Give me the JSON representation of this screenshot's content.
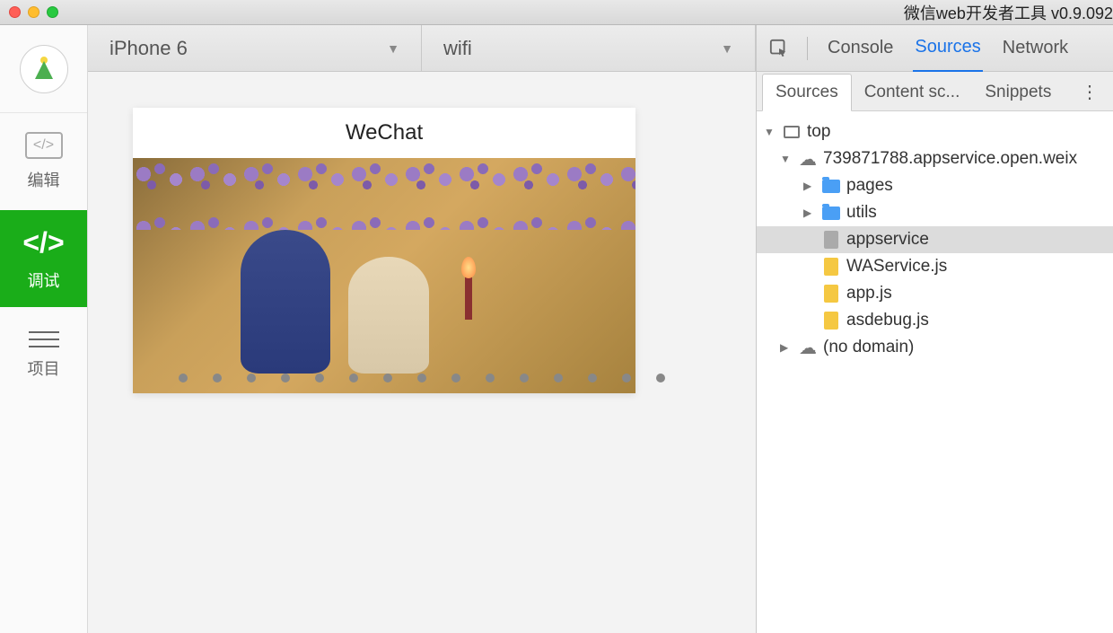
{
  "window": {
    "title": "微信web开发者工具 v0.9.092"
  },
  "sidebar": {
    "edit_label": "编辑",
    "debug_label": "调试",
    "project_label": "项目"
  },
  "toolbar": {
    "device": "iPhone 6",
    "network": "wifi"
  },
  "preview": {
    "header": "WeChat"
  },
  "devtools": {
    "tabs": {
      "console": "Console",
      "sources": "Sources",
      "network": "Network"
    },
    "subtabs": {
      "sources": "Sources",
      "content_scripts": "Content sc...",
      "snippets": "Snippets"
    },
    "tree": {
      "top": "top",
      "domain": "739871788.appservice.open.weix",
      "pages": "pages",
      "utils": "utils",
      "appservice": "appservice",
      "waservice": "WAService.js",
      "appjs": "app.js",
      "asdebug": "asdebug.js",
      "nodomain": "(no domain)"
    }
  }
}
